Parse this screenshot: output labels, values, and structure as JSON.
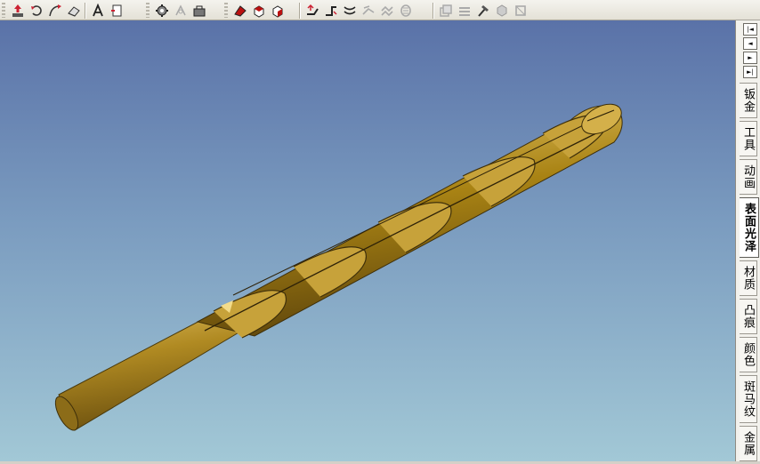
{
  "toolbar": {
    "groups": [
      {
        "buttons": [
          {
            "icon": "move-up-icon"
          },
          {
            "icon": "rotate-icon"
          },
          {
            "icon": "curve-arrow-icon"
          },
          {
            "icon": "eraser-icon"
          },
          {
            "icon": "text-a-icon"
          },
          {
            "icon": "page-tool-icon"
          }
        ]
      },
      {
        "buttons": [
          {
            "icon": "gear-tool-icon"
          },
          {
            "icon": "assembly-disabled-icon"
          },
          {
            "icon": "tool-chest-icon"
          }
        ]
      },
      {
        "buttons": [
          {
            "icon": "red-face-icon"
          },
          {
            "icon": "red-cube-face-icon"
          },
          {
            "icon": "red-cube-side-icon"
          }
        ]
      },
      {
        "buttons": [
          {
            "icon": "sheet-bend-icon"
          },
          {
            "icon": "sheet-fold-icon"
          },
          {
            "icon": "sheet-flatten-icon"
          },
          {
            "icon": "sheet-stretch-disabled-icon"
          },
          {
            "icon": "sheet-pattern-disabled-icon"
          },
          {
            "icon": "sheet-roll-disabled-icon"
          }
        ]
      },
      {
        "buttons": [
          {
            "icon": "copy-disabled-icon"
          },
          {
            "icon": "stack-disabled-icon"
          },
          {
            "icon": "hammer-icon"
          },
          {
            "icon": "cube-disabled-icon"
          },
          {
            "icon": "frame-disabled-icon"
          }
        ]
      }
    ]
  },
  "right_panel": {
    "nav": [
      "|◄",
      "◄",
      "►",
      "►|"
    ],
    "tabs": [
      {
        "label": "钣金",
        "active": false
      },
      {
        "label": "工具",
        "active": false
      },
      {
        "label": "动画",
        "active": false
      },
      {
        "label": "表面光泽",
        "active": true
      },
      {
        "label": "材质",
        "active": false
      },
      {
        "label": "凸痕",
        "active": false
      },
      {
        "label": "颜色",
        "active": false
      },
      {
        "label": "斑马纹",
        "active": false
      },
      {
        "label": "金属",
        "active": false
      }
    ]
  },
  "scene": {
    "object": "drill-bit-model",
    "material_color": "#b08a22",
    "background_top": "#5a72a8",
    "background_bottom": "#a2c8d6"
  }
}
